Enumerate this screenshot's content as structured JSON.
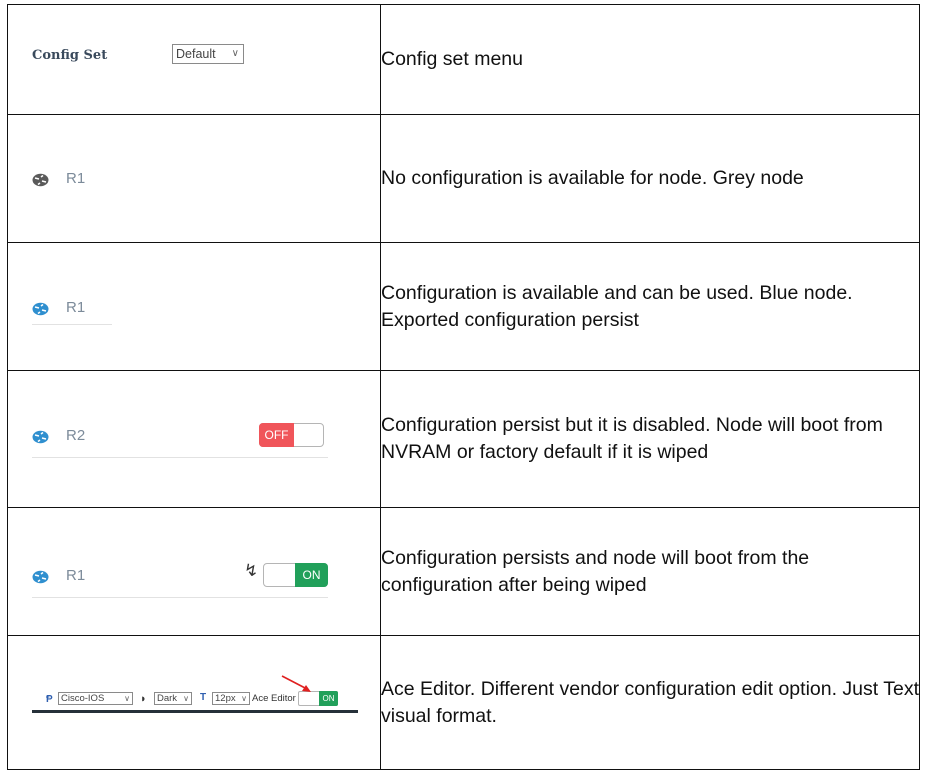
{
  "rows": [
    {
      "description": "Config set menu",
      "config_label": "Config Set",
      "select_value": "Default",
      "icon": "chevron-down-icon"
    },
    {
      "description": "No configuration is available for node. Grey node",
      "node": "R1",
      "node_color": "#5a5a5a",
      "icon": "router-icon"
    },
    {
      "description": "Configuration is available and can be used. Blue node. Exported configuration persist",
      "node": "R1",
      "node_color": "#2f8fcf",
      "icon": "router-icon"
    },
    {
      "description": "Configuration persist but it is disabled. Node will boot from NVRAM or factory default if it is wiped",
      "node": "R2",
      "node_color": "#2f8fcf",
      "toggle_label": "OFF",
      "toggle_color": "#f0555a"
    },
    {
      "description": "Configuration persists and node will boot from the configuration after being wiped",
      "node": "R1",
      "node_color": "#2f8fcf",
      "toggle_label": "ON",
      "toggle_color": "#21a05a",
      "icon": "bolt-icon"
    },
    {
      "description": "Ace Editor. Different vendor configuration edit option. Just Text visual format.",
      "vendor": "Cisco-IOS",
      "theme": "Dark",
      "font_size": "12px",
      "editor_label": "Ace Editor",
      "toggle_label": "ON",
      "arrow_color": "#e02020"
    }
  ]
}
